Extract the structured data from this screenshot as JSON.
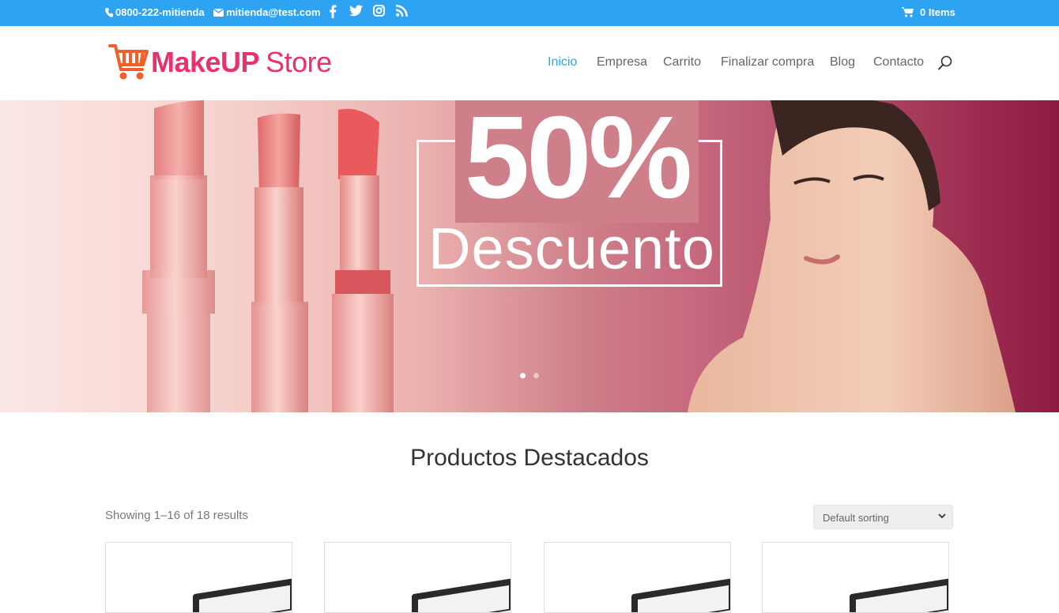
{
  "topbar": {
    "phone": "0800-222-mitienda",
    "email": "mitienda@test.com",
    "social_icons": [
      "facebook-icon",
      "twitter-icon",
      "instagram-icon",
      "rss-icon"
    ],
    "cart_label": "0 Items",
    "bg_color": "#2ea3f2"
  },
  "header": {
    "logo_make": "MakeUP",
    "logo_store": "Store",
    "nav": [
      {
        "label": "Inicio",
        "active": true
      },
      {
        "label": "Empresa",
        "active": false
      },
      {
        "label": "Carrito",
        "active": false
      },
      {
        "label": "Finalizar compra",
        "active": false
      },
      {
        "label": "Blog",
        "active": false
      },
      {
        "label": "Contacto",
        "active": false
      }
    ],
    "accent_color": "#2ea3f2",
    "brand_color": "#e8316f"
  },
  "hero": {
    "promo_value": "50%",
    "promo_label": "Descuento",
    "slides": 2,
    "active_slide": 1
  },
  "main": {
    "title": "Productos Destacados",
    "results": "Showing 1–16 of 18 results",
    "sorting_selected": "Default sorting"
  }
}
